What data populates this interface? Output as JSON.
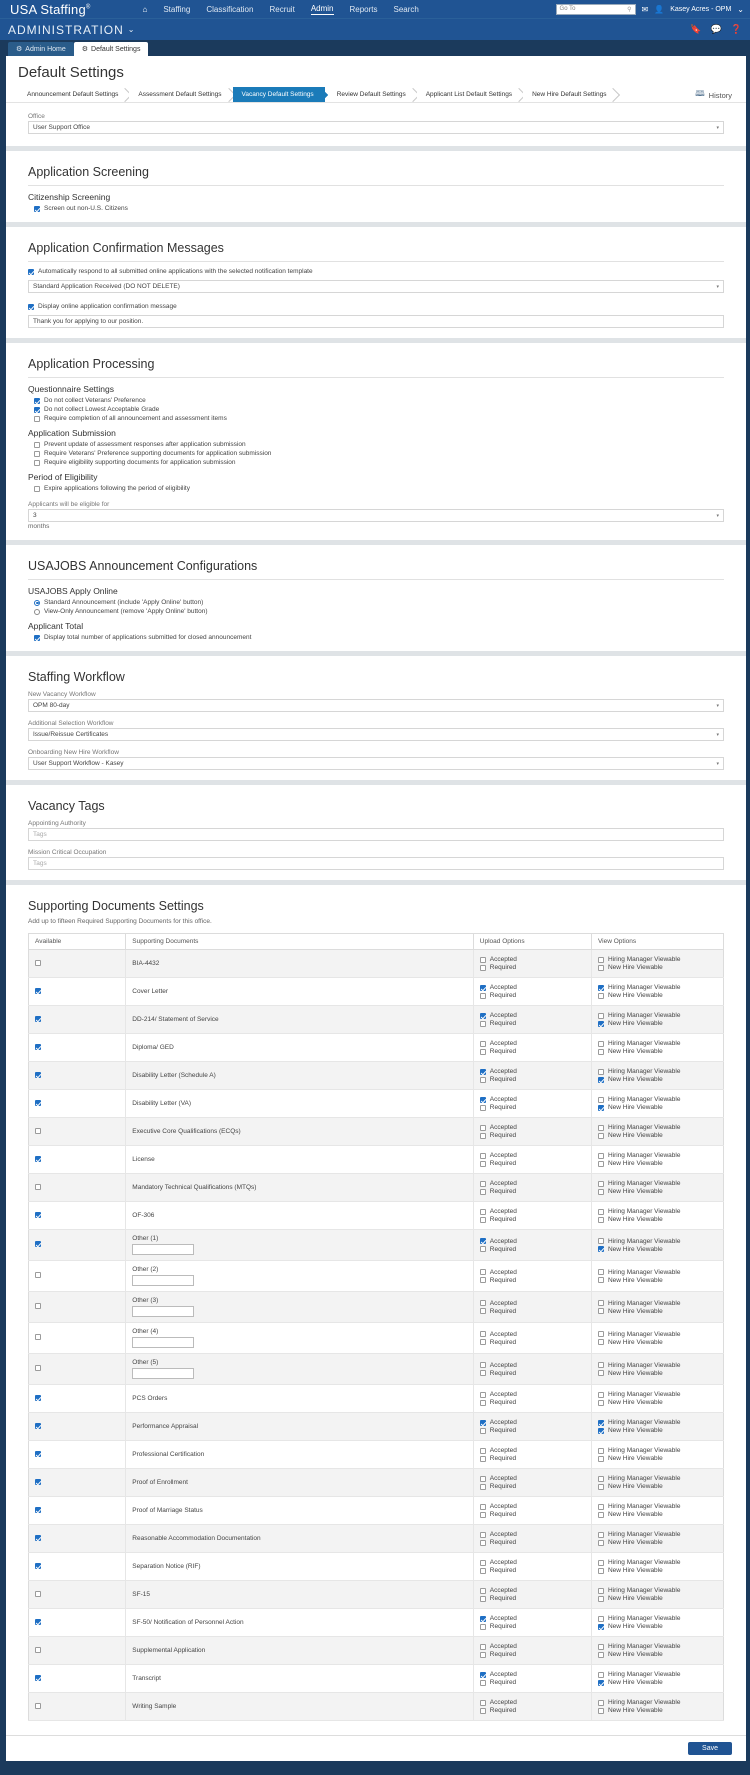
{
  "topnav": {
    "brand": "USA Staffing",
    "brand_sup": "®",
    "home_icon": "home-icon",
    "links": [
      {
        "label": "Staffing",
        "active": false
      },
      {
        "label": "Classification",
        "active": false
      },
      {
        "label": "Recruit",
        "active": false
      },
      {
        "label": "Admin",
        "active": true
      },
      {
        "label": "Reports",
        "active": false,
        "caret": "⌄"
      },
      {
        "label": "Search",
        "active": false
      }
    ],
    "goto_placeholder": "Go To",
    "mail_icon": "envelope-icon",
    "user_icon": "user-icon",
    "username": "Kasey Acres - OPM",
    "user_caret": "⌄"
  },
  "adminbar": {
    "title": "ADMINISTRATION",
    "caret": "⌄",
    "icons": [
      "bookmark-icon",
      "chat-icon",
      "help-icon"
    ]
  },
  "tabs": [
    {
      "label": "Admin Home",
      "icon": "gear-icon",
      "active": false
    },
    {
      "label": "Default Settings",
      "icon": "gear-icon",
      "active": true
    }
  ],
  "page": {
    "title": "Default Settings",
    "history_label": "History",
    "history_icon": "history-icon"
  },
  "crumbs": [
    {
      "label": "Announcement Default Settings",
      "active": false
    },
    {
      "label": "Assessment Default Settings",
      "active": false
    },
    {
      "label": "Vacancy Default Settings",
      "active": true
    },
    {
      "label": "Review Default Settings",
      "active": false
    },
    {
      "label": "Applicant List Default Settings",
      "active": false
    },
    {
      "label": "New Hire Default Settings",
      "active": false
    }
  ],
  "office": {
    "label": "Office",
    "value": "User Support Office"
  },
  "application_screening": {
    "title": "Application Screening",
    "subhead": "Citizenship Screening",
    "checkbox": {
      "label": "Screen out non-U.S. Citizens",
      "checked": true
    }
  },
  "confirmation_messages": {
    "title": "Application Confirmation Messages",
    "auto_respond": {
      "label": "Automatically respond to all submitted online applications with the selected notification template",
      "checked": true
    },
    "template_value": "Standard Application Received (DO NOT DELETE)",
    "display_message": {
      "label": "Display online application confirmation message",
      "checked": true
    },
    "message_value": "Thank you for applying to our position."
  },
  "application_processing": {
    "title": "Application Processing",
    "questionnaire_subhead": "Questionnaire Settings",
    "questionnaire_items": [
      {
        "label": "Do not collect Veterans' Preference",
        "checked": true
      },
      {
        "label": "Do not collect Lowest Acceptable Grade",
        "checked": true
      },
      {
        "label": "Require completion of all announcement and assessment items",
        "checked": false
      }
    ],
    "submission_subhead": "Application Submission",
    "submission_items": [
      {
        "label": "Prevent update of assessment responses after application submission",
        "checked": false
      },
      {
        "label": "Require Veterans' Preference supporting documents for application submission",
        "checked": false
      },
      {
        "label": "Require eligibility supporting documents for application submission",
        "checked": false
      }
    ],
    "eligibility_subhead": "Period of Eligibility",
    "eligibility_items": [
      {
        "label": "Expire applications following the period of eligibility",
        "checked": false
      }
    ],
    "eligible_label": "Applicants will be eligible for",
    "eligible_value": "3",
    "eligible_unit": "months"
  },
  "usajobs": {
    "title": "USAJOBS Announcement Configurations",
    "apply_subhead": "USAJOBS Apply Online",
    "radios": [
      {
        "label": "Standard Announcement (include 'Apply Online' button)",
        "selected": true
      },
      {
        "label": "View-Only Announcement (remove 'Apply Online' button)",
        "selected": false
      }
    ],
    "total_subhead": "Applicant Total",
    "total_checkbox": {
      "label": "Display total number of applications submitted for closed announcement",
      "checked": true
    }
  },
  "staffing_workflow": {
    "title": "Staffing Workflow",
    "fields": [
      {
        "label": "New Vacancy Workflow",
        "value": "OPM 80-day"
      },
      {
        "label": "Additional Selection Workflow",
        "value": "Issue/Reissue Certificates"
      },
      {
        "label": "Onboarding New Hire Workflow",
        "value": "User Support Workflow - Kasey"
      }
    ]
  },
  "vacancy_tags": {
    "title": "Vacancy Tags",
    "fields": [
      {
        "label": "Appointing Authority",
        "placeholder": "Tags"
      },
      {
        "label": "Mission Critical Occupation",
        "placeholder": "Tags"
      }
    ]
  },
  "supporting_documents": {
    "title": "Supporting Documents Settings",
    "note": "Add up to fifteen Required Supporting Documents for this office.",
    "columns": [
      "Available",
      "Supporting Documents",
      "Upload Options",
      "View Options"
    ],
    "labels": {
      "accepted": "Accepted",
      "required": "Required",
      "hm_viewable": "Hiring Manager Viewable",
      "nh_viewable": "New Hire Viewable"
    },
    "rows": [
      {
        "name": "BIA-4432",
        "available": false,
        "accepted": false,
        "required": false,
        "hm": false,
        "nh": false,
        "input": false
      },
      {
        "name": "Cover Letter",
        "available": true,
        "accepted": true,
        "required": false,
        "hm": true,
        "nh": false,
        "input": false
      },
      {
        "name": "DD-214/ Statement of Service",
        "available": true,
        "accepted": true,
        "required": false,
        "hm": false,
        "nh": true,
        "input": false
      },
      {
        "name": "Diploma/ GED",
        "available": true,
        "accepted": false,
        "required": false,
        "hm": false,
        "nh": false,
        "input": false
      },
      {
        "name": "Disability Letter (Schedule A)",
        "available": true,
        "accepted": true,
        "required": false,
        "hm": false,
        "nh": true,
        "input": false
      },
      {
        "name": "Disability Letter (VA)",
        "available": true,
        "accepted": true,
        "required": false,
        "hm": false,
        "nh": true,
        "input": false
      },
      {
        "name": "Executive Core Qualifications (ECQs)",
        "available": false,
        "accepted": false,
        "required": false,
        "hm": false,
        "nh": false,
        "input": false
      },
      {
        "name": "License",
        "available": true,
        "accepted": false,
        "required": false,
        "hm": false,
        "nh": false,
        "input": false
      },
      {
        "name": "Mandatory Technical Qualifications (MTQs)",
        "available": false,
        "accepted": false,
        "required": false,
        "hm": false,
        "nh": false,
        "input": false
      },
      {
        "name": "OF-306",
        "available": true,
        "accepted": false,
        "required": false,
        "hm": false,
        "nh": false,
        "input": false
      },
      {
        "name": "Other (1)",
        "available": true,
        "accepted": true,
        "required": false,
        "hm": false,
        "nh": true,
        "input": true,
        "input_value": ""
      },
      {
        "name": "Other (2)",
        "available": false,
        "accepted": false,
        "required": false,
        "hm": false,
        "nh": false,
        "input": true,
        "input_value": ""
      },
      {
        "name": "Other (3)",
        "available": false,
        "accepted": false,
        "required": false,
        "hm": false,
        "nh": false,
        "input": true,
        "input_value": ""
      },
      {
        "name": "Other (4)",
        "available": false,
        "accepted": false,
        "required": false,
        "hm": false,
        "nh": false,
        "input": true,
        "input_value": ""
      },
      {
        "name": "Other (5)",
        "available": false,
        "accepted": false,
        "required": false,
        "hm": false,
        "nh": false,
        "input": true,
        "input_value": ""
      },
      {
        "name": "PCS Orders",
        "available": true,
        "accepted": false,
        "required": false,
        "hm": false,
        "nh": false,
        "input": false
      },
      {
        "name": "Performance Appraisal",
        "available": true,
        "accepted": true,
        "required": false,
        "hm": true,
        "nh": true,
        "input": false
      },
      {
        "name": "Professional Certification",
        "available": true,
        "accepted": false,
        "required": false,
        "hm": false,
        "nh": false,
        "input": false
      },
      {
        "name": "Proof of Enrollment",
        "available": true,
        "accepted": false,
        "required": false,
        "hm": false,
        "nh": false,
        "input": false
      },
      {
        "name": "Proof of Marriage Status",
        "available": true,
        "accepted": false,
        "required": false,
        "hm": false,
        "nh": false,
        "input": false
      },
      {
        "name": "Reasonable Accommodation Documentation",
        "available": true,
        "accepted": false,
        "required": false,
        "hm": false,
        "nh": false,
        "input": false
      },
      {
        "name": "Separation Notice (RIF)",
        "available": true,
        "accepted": false,
        "required": false,
        "hm": false,
        "nh": false,
        "input": false
      },
      {
        "name": "SF-15",
        "available": false,
        "accepted": false,
        "required": false,
        "hm": false,
        "nh": false,
        "input": false
      },
      {
        "name": "SF-50/ Notification of Personnel Action",
        "available": true,
        "accepted": true,
        "required": false,
        "hm": false,
        "nh": true,
        "input": false
      },
      {
        "name": "Supplemental Application",
        "available": false,
        "accepted": false,
        "required": false,
        "hm": false,
        "nh": false,
        "input": false
      },
      {
        "name": "Transcript",
        "available": true,
        "accepted": true,
        "required": false,
        "hm": false,
        "nh": true,
        "input": false
      },
      {
        "name": "Writing Sample",
        "available": false,
        "accepted": false,
        "required": false,
        "hm": false,
        "nh": false,
        "input": false
      }
    ]
  },
  "footer": {
    "save_label": "Save"
  },
  "colors": {
    "header_blue": "#205493",
    "accent_blue": "#1b7bb9",
    "checkbox_blue": "#1f6fc4",
    "page_bg": "#1b3a5c"
  }
}
